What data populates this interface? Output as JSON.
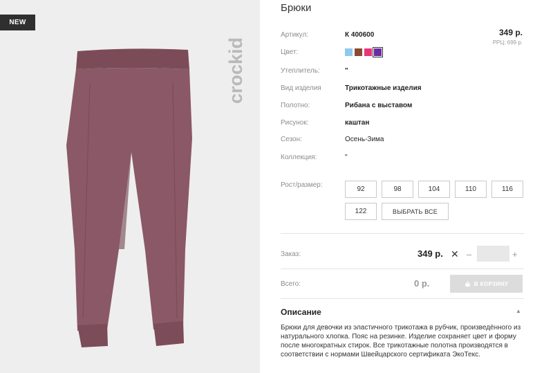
{
  "badge": {
    "label": "NEW"
  },
  "brand": {
    "watermark": "crockid"
  },
  "product": {
    "title": "Брюки",
    "price": "349 р.",
    "rrp": "РРЦ: 699 р."
  },
  "specs": [
    {
      "label": "Артикул:",
      "value": "К 400600"
    },
    {
      "label": "Цвет:",
      "value": ""
    },
    {
      "label": "Утеплитель:",
      "value": "\""
    },
    {
      "label": "Вид изделия",
      "value": "Трикотажные изделия"
    },
    {
      "label": "Полотно:",
      "value": "Рибана с выставом"
    },
    {
      "label": "Рисунок:",
      "value": "каштан"
    },
    {
      "label": "Сезон:",
      "value": "Осень-Зима"
    },
    {
      "label": "Коллекция:",
      "value": "\""
    }
  ],
  "colors": [
    {
      "name": "light-blue",
      "hex": "#8ec9f0",
      "selected": false
    },
    {
      "name": "brown",
      "hex": "#8a4a32",
      "selected": false
    },
    {
      "name": "pink",
      "hex": "#e8357a",
      "selected": false
    },
    {
      "name": "purple",
      "hex": "#6a2ca0",
      "selected": true
    }
  ],
  "sizes": {
    "label": "Рост/размер:",
    "options": [
      "92",
      "98",
      "104",
      "110",
      "116",
      "122"
    ],
    "select_all": "ВЫБРАТЬ ВСЕ"
  },
  "order": {
    "label": "Заказ:",
    "price": "349 р.",
    "times": "✕",
    "minus": "–",
    "plus": "+",
    "quantity": ""
  },
  "total": {
    "label": "Всего:",
    "price": "0 р.",
    "cart_button": "В КОРЗИНУ"
  },
  "description": {
    "title": "Описание",
    "toggle": "▲",
    "text": "Брюки для девочки из эластичного трикотажа в рубчик, произведённого из натурального хлопка. Пояс на резинке. Изделие сохраняет цвет и форму после многократных стирок. Все трикотажные полотна производятся в соответствии с нормами Швейцарского сертификата ЭкоТекс."
  }
}
